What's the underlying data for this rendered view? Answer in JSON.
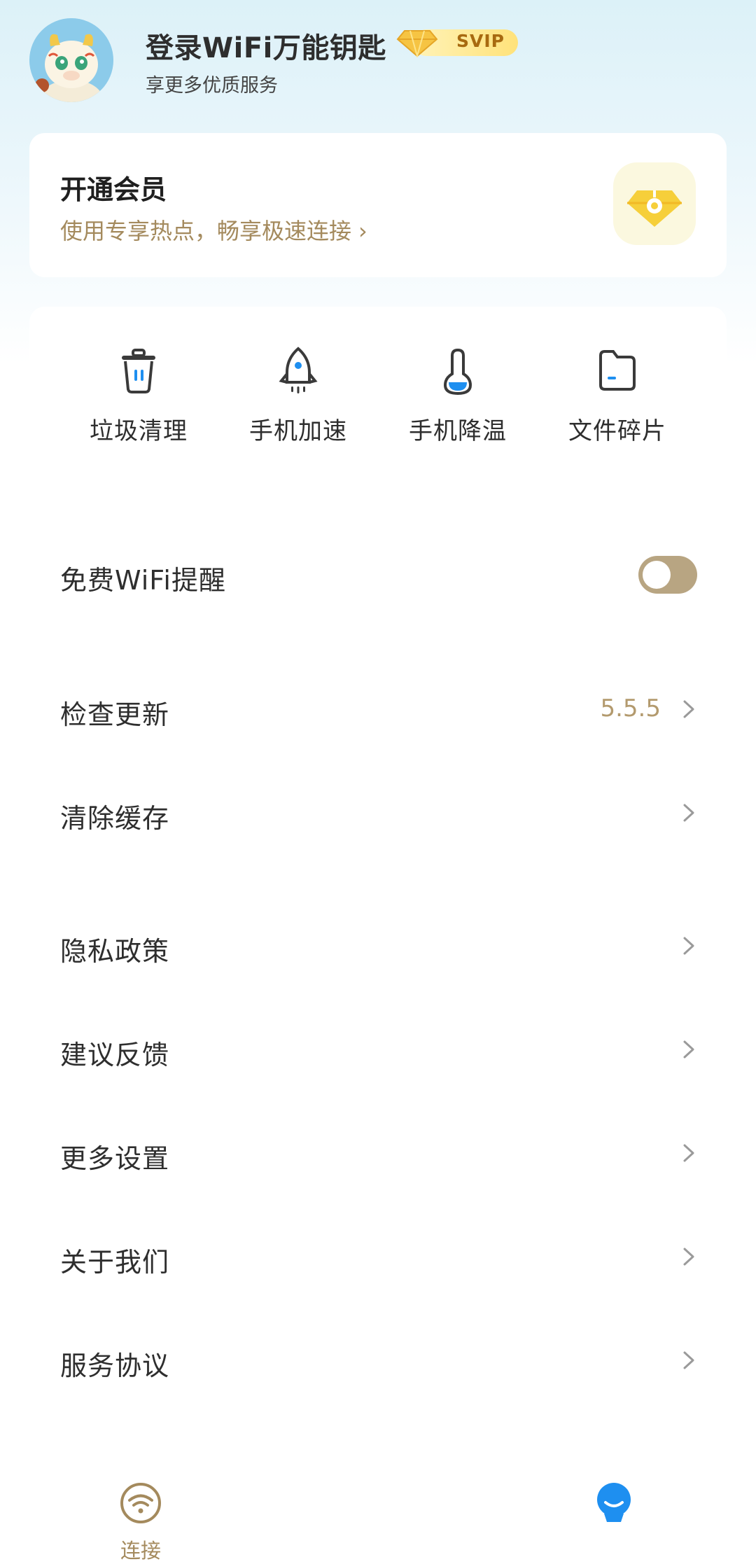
{
  "header": {
    "title": "登录WiFi万能钥匙",
    "badge": "SVIP",
    "subtitle": "享更多优质服务",
    "avatar": "dragon-mascot-avatar"
  },
  "member": {
    "title": "开通会员",
    "subtitle": "使用专享热点，畅享极速连接",
    "chevron": "›",
    "icon": "diamond-icon"
  },
  "tools": [
    {
      "label": "垃圾清理",
      "icon": "trash-icon"
    },
    {
      "label": "手机加速",
      "icon": "rocket-icon"
    },
    {
      "label": "手机降温",
      "icon": "thermometer-icon"
    },
    {
      "label": "文件碎片",
      "icon": "folder-icon"
    }
  ],
  "settings": {
    "free_wifi_reminder": {
      "label": "免费WiFi提醒",
      "enabled": false
    },
    "check_update": {
      "label": "检查更新",
      "value": "5.5.5"
    },
    "clear_cache": {
      "label": "清除缓存"
    },
    "privacy_policy": {
      "label": "隐私政策"
    },
    "feedback": {
      "label": "建议反馈"
    },
    "more_settings": {
      "label": "更多设置"
    },
    "about_us": {
      "label": "关于我们"
    },
    "service_agreement": {
      "label": "服务协议"
    }
  },
  "nav": {
    "connect": {
      "label": "连接",
      "icon": "wifi-icon"
    },
    "profile": {
      "label": "",
      "icon": "profile-icon",
      "active": true
    }
  },
  "colors": {
    "accent_gold": "#a48a5d",
    "toggle_off": "#b8a582",
    "active_blue": "#1e8ff0"
  }
}
